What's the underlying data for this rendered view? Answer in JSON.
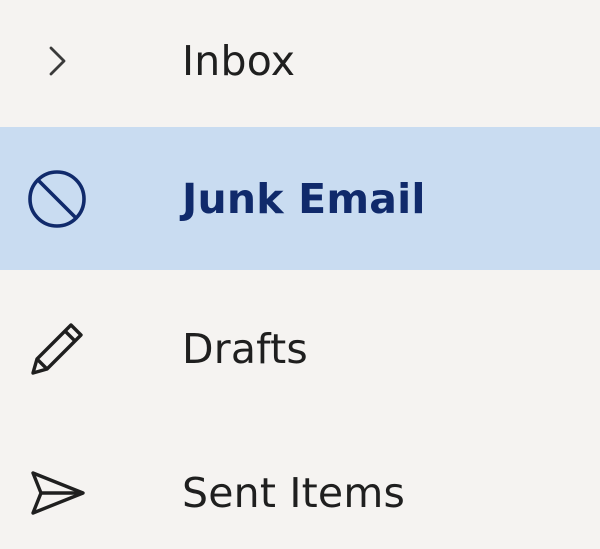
{
  "folders": [
    {
      "label": "Inbox",
      "icon": "chevron-right-icon",
      "selected": false
    },
    {
      "label": "Junk Email",
      "icon": "block-icon",
      "selected": true
    },
    {
      "label": "Drafts",
      "icon": "pencil-icon",
      "selected": false
    },
    {
      "label": "Sent Items",
      "icon": "send-icon",
      "selected": false
    }
  ],
  "colors": {
    "background": "#f5f3f1",
    "selected_background": "#c9dcf1",
    "selected_text": "#102a6b",
    "text": "#1f1f1f"
  }
}
